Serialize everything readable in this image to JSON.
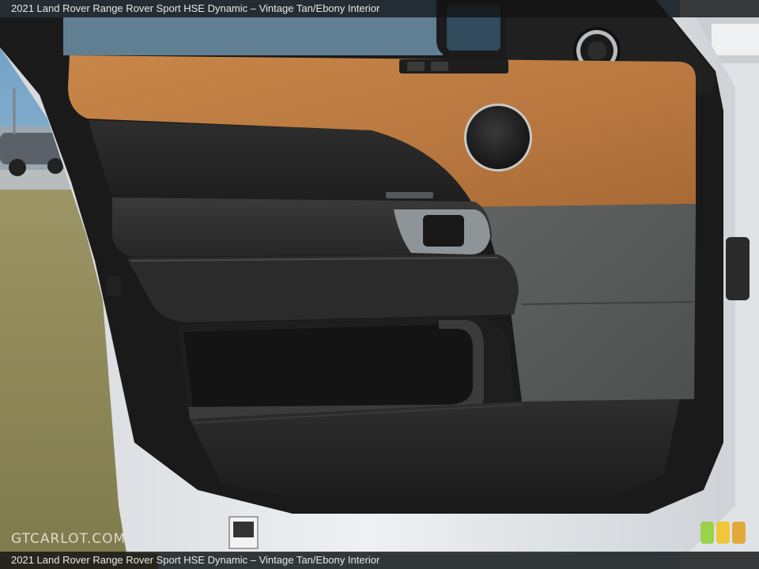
{
  "caption": {
    "top": "2021 Land Rover Range Rover Sport HSE Dynamic – Vintage Tan/Ebony Interior",
    "bottom": "2021 Land Rover Range Rover Sport HSE Dynamic – Vintage Tan/Ebony Interior"
  },
  "watermark": "GTCARLOT.COM",
  "colors": {
    "tan_leather": "#b8773f",
    "ebony_leather": "#262626",
    "gray_fabric": "#5a5c5c",
    "body_white": "#e6e9ec",
    "grass": "#8e8a58",
    "sky": "#8fb8d6"
  },
  "thumb_colors": [
    "#9bd24a",
    "#f0c63a",
    "#e2a93a"
  ]
}
